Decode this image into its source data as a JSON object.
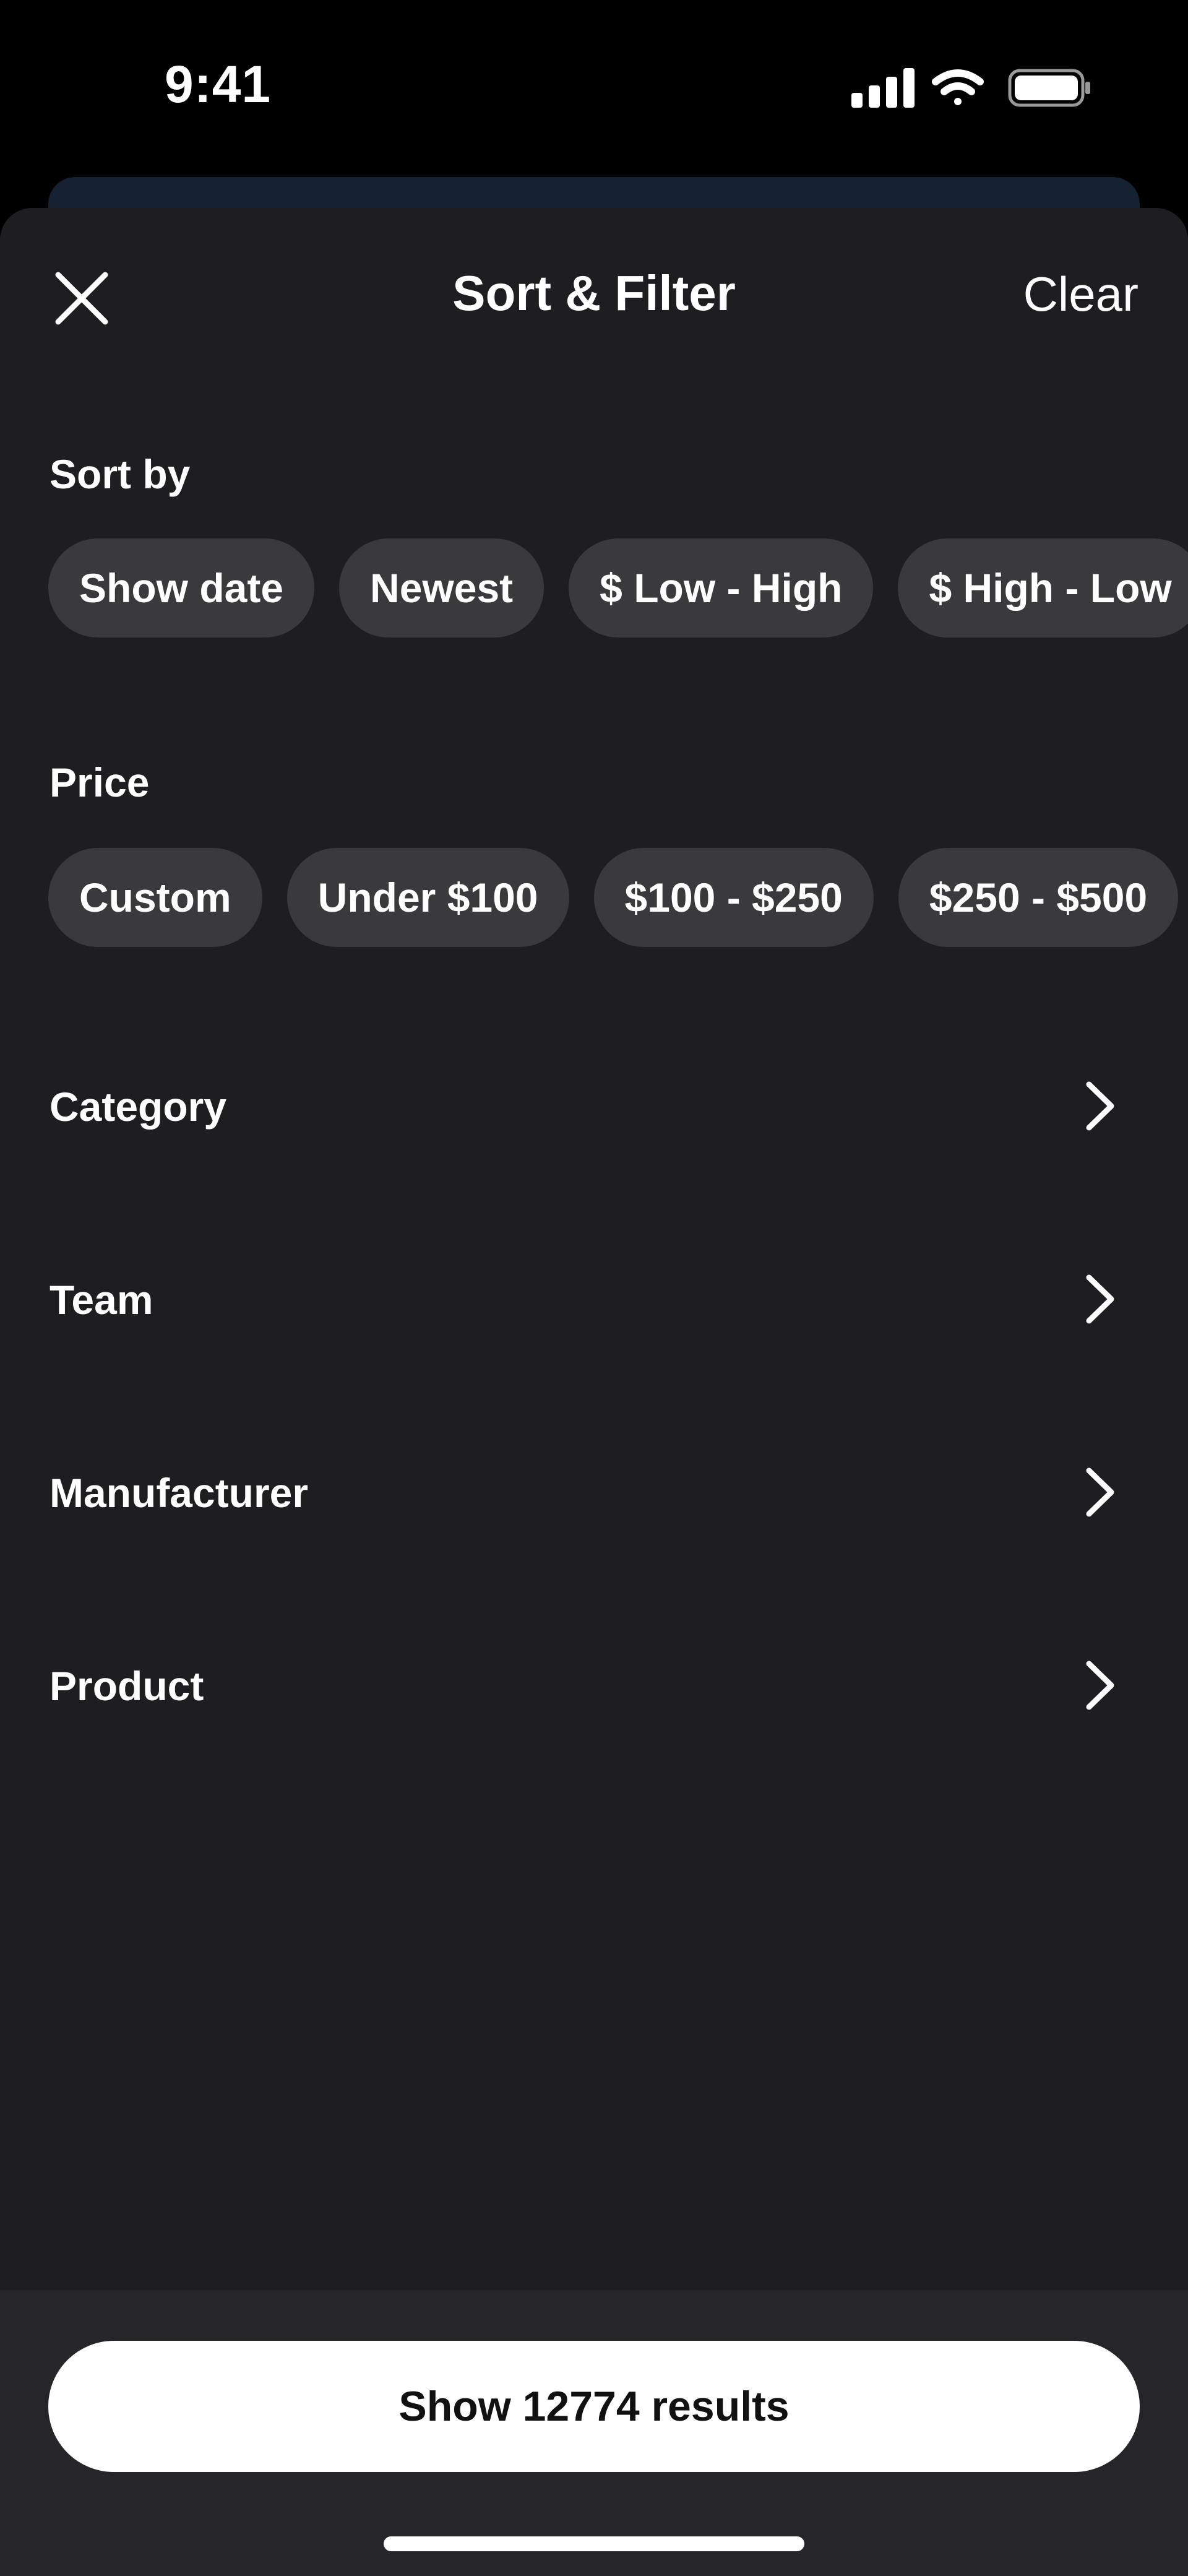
{
  "status_bar": {
    "time": "9:41"
  },
  "header": {
    "title": "Sort & Filter",
    "clear_label": "Clear"
  },
  "sort": {
    "label": "Sort by",
    "options": [
      "Show date",
      "Newest",
      "$ Low - High",
      "$ High - Low"
    ]
  },
  "price": {
    "label": "Price",
    "options": [
      "Custom",
      "Under $100",
      "$100 - $250",
      "$250 - $500"
    ]
  },
  "filters": [
    {
      "label": "Category"
    },
    {
      "label": "Team"
    },
    {
      "label": "Manufacturer"
    },
    {
      "label": "Product"
    }
  ],
  "footer": {
    "results_label": "Show 12774 results"
  },
  "colors": {
    "background": "#000000",
    "sheet": "#1e1e20",
    "chip": "#3a3a3d",
    "button": "#ffffff",
    "under_sheet": "#152232"
  },
  "icons": [
    "close-icon",
    "chevron-right-icon",
    "signal-icon",
    "wifi-icon",
    "battery-icon"
  ]
}
